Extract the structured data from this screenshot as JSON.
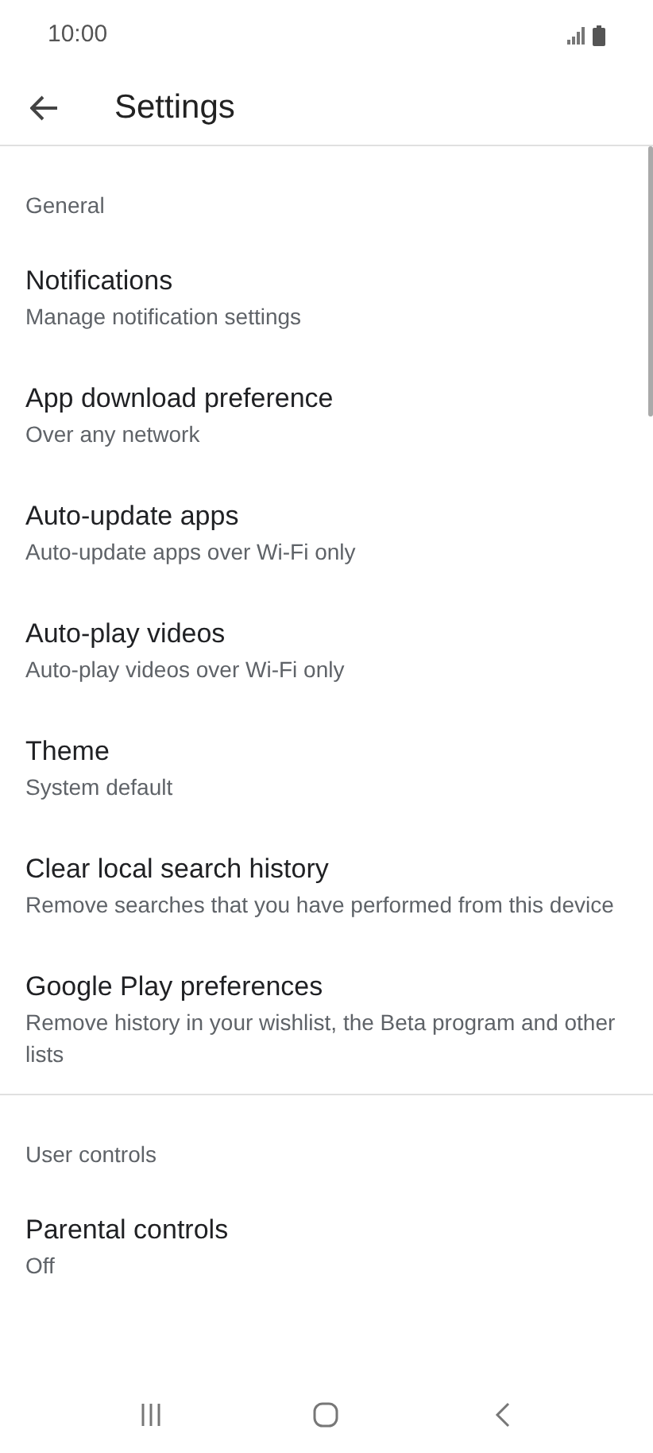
{
  "status_bar": {
    "time": "10:00"
  },
  "header": {
    "title": "Settings"
  },
  "sections": [
    {
      "title": "General",
      "items": [
        {
          "title": "Notifications",
          "subtitle": "Manage notification settings"
        },
        {
          "title": "App download preference",
          "subtitle": "Over any network"
        },
        {
          "title": "Auto-update apps",
          "subtitle": "Auto-update apps over Wi-Fi only"
        },
        {
          "title": "Auto-play videos",
          "subtitle": "Auto-play videos over Wi-Fi only"
        },
        {
          "title": "Theme",
          "subtitle": "System default"
        },
        {
          "title": "Clear local search history",
          "subtitle": "Remove searches that you have performed from this device"
        },
        {
          "title": "Google Play preferences",
          "subtitle": "Remove history in your wishlist, the Beta program and other lists"
        }
      ]
    },
    {
      "title": "User controls",
      "items": [
        {
          "title": "Parental controls",
          "subtitle": "Off"
        }
      ]
    }
  ]
}
